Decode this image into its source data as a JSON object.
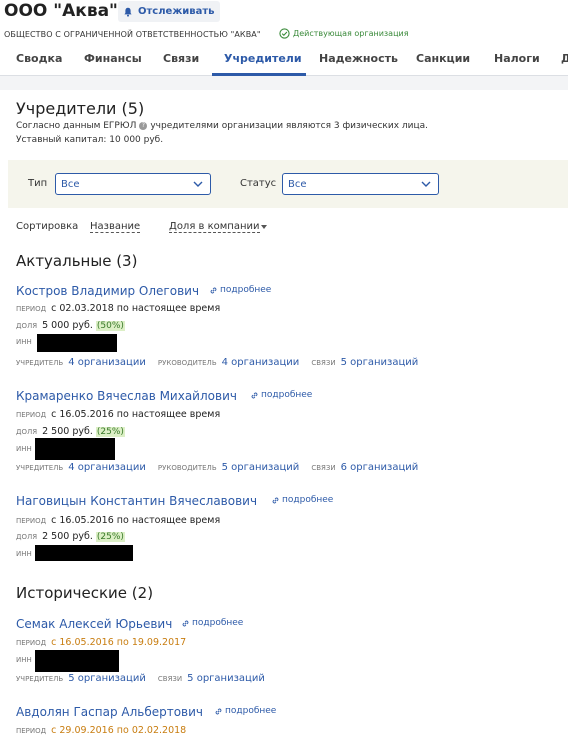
{
  "org": {
    "title": "ООО \"Аква\"",
    "follow_label": "Отслеживать",
    "full_name": "ОБЩЕСТВО С ОГРАНИЧЕННОЙ ОТВЕТСТВЕННОСТЬЮ \"АКВА\"",
    "status": "Действующая организация"
  },
  "tabs": [
    {
      "label": "Сводка"
    },
    {
      "label": "Финансы"
    },
    {
      "label": "Связи"
    },
    {
      "label": "Учредители",
      "active": true
    },
    {
      "label": "Надежность"
    },
    {
      "label": "Санкции"
    },
    {
      "label": "Налоги"
    },
    {
      "label": "Д"
    }
  ],
  "founders": {
    "title": "Учредители (5)",
    "info_prefix": "Согласно данным ЕГРЮЛ",
    "info_suffix": "учредителями организации являются 3 физических лица.",
    "capital": "Уставный капитал: 10 000 руб."
  },
  "filters": {
    "type_label": "Тип",
    "type_value": "Все",
    "status_label": "Статус",
    "status_value": "Все"
  },
  "sort": {
    "label": "Сортировка",
    "option_name": "Название",
    "option_share": "Доля в компании"
  },
  "labels": {
    "period": "ПЕРИОД",
    "share": "ДОЛЯ",
    "inn": "ИНН",
    "founder": "УЧРЕДИТЕЛЬ",
    "manager": "РУКОВОДИТЕЛЬ",
    "links": "СВЯЗИ",
    "more": "подробнее"
  },
  "actual": {
    "title": "Актуальные (3)",
    "people": [
      {
        "name": "Костров Владимир Олегович",
        "period": "с 02.03.2018 по настоящее время",
        "share": "5 000 руб.",
        "share_pct": "(50%)",
        "founder_link": "4 организации",
        "manager_link": "4 организации",
        "links_link": "5 организаций"
      },
      {
        "name": "Крамаренко Вячеслав Михайлович",
        "period": "с 16.05.2016 по настоящее время",
        "share": "2 500 руб.",
        "share_pct": "(25%)",
        "founder_link": "4 организации",
        "manager_link": "5 организаций",
        "links_link": "6 организаций"
      },
      {
        "name": "Наговицын Константин Вячеславович",
        "period": "с 16.05.2016 по настоящее время",
        "share": "2 500 руб.",
        "share_pct": "(25%)"
      }
    ]
  },
  "historical": {
    "title": "Исторические (2)",
    "people": [
      {
        "name": "Семак Алексей Юрьевич",
        "period": "с 16.05.2016 по 19.09.2017",
        "founder_link": "5 организаций",
        "links_link": "5 организаций"
      },
      {
        "name": "Авдолян Гаспар Альбертович",
        "period": "с 29.09.2016 по 02.02.2018"
      }
    ]
  },
  "colors": {
    "accent": "#2d5aa8",
    "active_status": "#3a8a3a",
    "historical_period": "#c87d10",
    "share_badge_bg": "#dcefc6"
  }
}
